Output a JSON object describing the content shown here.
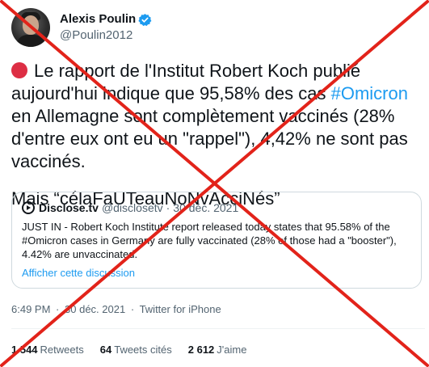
{
  "author": {
    "display_name": "Alexis Poulin",
    "handle": "@Poulin2012",
    "verified": true,
    "avatar_icon": "user-avatar"
  },
  "tweet": {
    "line1_before_hashtag": "Le rapport de l'Institut Robert Koch publié aujourd'hui indique que 95,58% des cas ",
    "hashtag": "#Omicron",
    "line1_after_hashtag": " en Allemagne sont complètement vaccinés (28% d'entre eux ont eu un \"rappel\"), 4,42% ne sont pas vaccinés.",
    "line2": "Mais “célaFaUTeauNoNvAcciNés”",
    "emoji_icon": "red-circle-icon"
  },
  "quoted": {
    "name": "Disclose.tv",
    "handle": "@disclosetv",
    "separator": "·",
    "date": "30 déc. 2021",
    "text": "JUST IN - Robert Koch Institute report released today states that 95.58% of the #Omicron cases in Germany are fully vaccinated (28% of those had a \"booster\"), 4.42% are unvaccinated.",
    "link": "Afficher cette discussion"
  },
  "meta": {
    "time": "6:49 PM",
    "sep1": "·",
    "date": "30 déc. 2021",
    "sep2": "·",
    "source": "Twitter for iPhone"
  },
  "stats": {
    "retweets_count": "1 544",
    "retweets_label": "Retweets",
    "quotes_count": "64",
    "quotes_label": "Tweets cités",
    "likes_count": "2 612",
    "likes_label": "J'aime"
  },
  "colors": {
    "link": "#1d9bf0",
    "text": "#0f1419",
    "muted": "#536471",
    "cross": "#e2231a",
    "emoji_red": "#dd2e44"
  }
}
